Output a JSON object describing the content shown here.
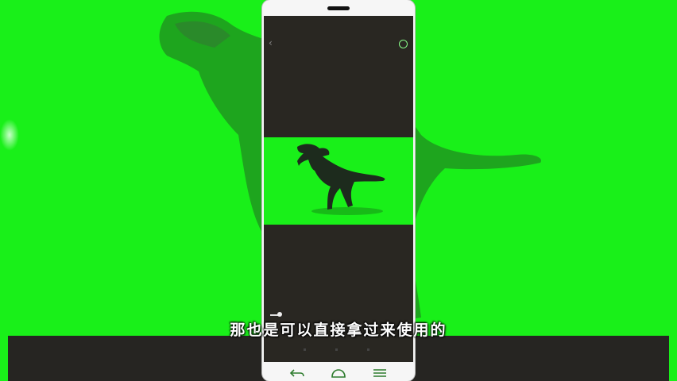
{
  "subtitle": {
    "text": "那也是可以直接拿过来使用的"
  },
  "phone": {
    "top_bar": {
      "back_icon": "chevron-left-icon",
      "right_icon": "circle-icon"
    },
    "video": {
      "subject": "dinosaur-silhouette",
      "background_color": "#19f019"
    },
    "nav_bar": {
      "icons": [
        "back-arrow-icon",
        "home-icon",
        "menu-icon"
      ]
    }
  },
  "colors": {
    "chroma_green": "#19f019",
    "screen_dark": "#292722",
    "bar_dark": "#262522",
    "phone_frame": "#f6f6f6"
  }
}
